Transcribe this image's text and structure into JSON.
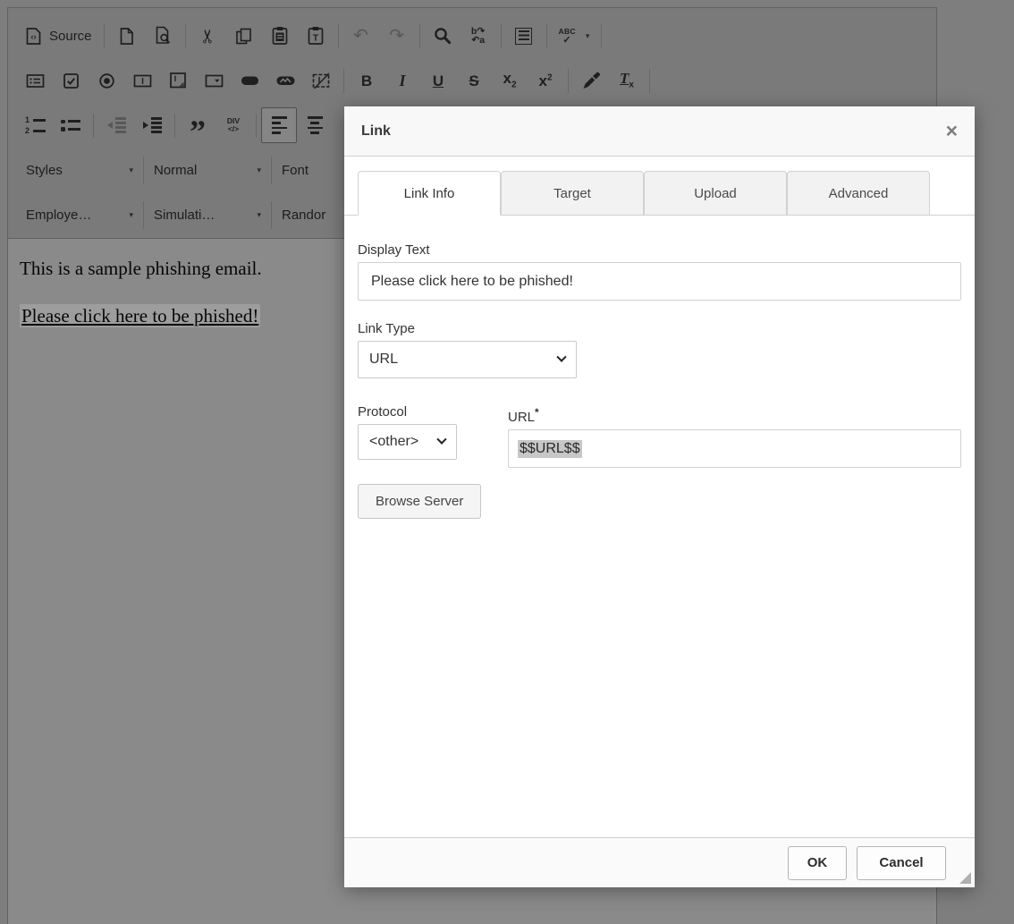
{
  "editor": {
    "toolbar": {
      "source_label": "Source",
      "glyphs": {
        "cut": "✂",
        "undo": "↶",
        "redo": "↷",
        "replace_top": "b↷",
        "replace_bottom": "↶a",
        "spell_abc": "ABC",
        "spell_check": "✓",
        "caret": "▾",
        "bold": "B",
        "italic": "I",
        "underline": "U",
        "strike": "S",
        "script_base": "x",
        "sub_digit": "2",
        "sup_digit": "2",
        "removeformat_base": "T",
        "removeformat_sub": "x",
        "quote": "”",
        "div_top": "DIV",
        "div_bottom": "</>",
        "num1": "1",
        "num2": "2",
        "field_i": "I"
      },
      "combos_row1": [
        {
          "label": "Styles"
        },
        {
          "label": "Normal"
        },
        {
          "label": "Font"
        }
      ],
      "combos_row2": [
        {
          "label": "Employe…"
        },
        {
          "label": "Simulati…"
        },
        {
          "label": "Randor"
        }
      ]
    },
    "content": {
      "paragraph": "This is a sample phishing email.",
      "selected_link": "Please click here to be phished!"
    }
  },
  "dialog": {
    "title": "Link",
    "close_glyph": "×",
    "tabs": [
      {
        "label": "Link Info"
      },
      {
        "label": "Target"
      },
      {
        "label": "Upload"
      },
      {
        "label": "Advanced"
      }
    ],
    "fields": {
      "display_text_label": "Display Text",
      "display_text_value": "Please click here to be phished!",
      "link_type_label": "Link Type",
      "link_type_value": "URL",
      "protocol_label": "Protocol",
      "protocol_value": "<other>",
      "url_label": "URL",
      "url_required_mark": "*",
      "url_value": "$$URL$$",
      "browse_server_label": "Browse Server"
    },
    "footer": {
      "ok_label": "OK",
      "cancel_label": "Cancel"
    }
  }
}
